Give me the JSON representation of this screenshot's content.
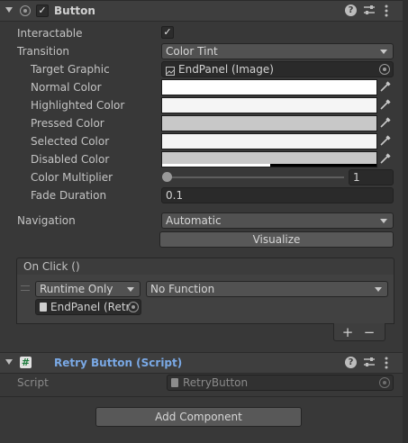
{
  "component": {
    "title": "Button",
    "enabled_check": "✓",
    "icons": [
      "help-icon",
      "presets-icon",
      "more-icon"
    ]
  },
  "props": {
    "interactable_label": "Interactable",
    "interactable_check": "✓",
    "transition_label": "Transition",
    "transition_value": "Color Tint",
    "target_graphic_label": "Target Graphic",
    "target_graphic_value": "EndPanel (Image)",
    "normal_label": "Normal Color",
    "highlighted_label": "Highlighted Color",
    "pressed_label": "Pressed Color",
    "selected_label": "Selected Color",
    "disabled_label": "Disabled Color",
    "multiplier_label": "Color Multiplier",
    "multiplier_value": "1",
    "fade_label": "Fade Duration",
    "fade_value": "0.1",
    "navigation_label": "Navigation",
    "navigation_value": "Automatic",
    "visualize_label": "Visualize"
  },
  "colors": {
    "normal": "#ffffff",
    "highlighted": "#f5f5f5",
    "pressed": "#c8c8c8",
    "selected": "#f5f5f5",
    "disabled": "#c8c8c8",
    "header_bg": "#3e3e3e",
    "panel_bg": "#383838",
    "script_title": "#7aa9e6"
  },
  "multiplier_slider_level": 0.0,
  "on_click": {
    "header": "On Click ()",
    "runtime": "Runtime Only",
    "function": "No Function",
    "object": "EndPanel (Retr",
    "add": "+",
    "remove": "−"
  },
  "script_component": {
    "title": "Retry Button (Script)",
    "script_label": "Script",
    "script_value": "RetryButton"
  },
  "add_component_label": "Add Component"
}
